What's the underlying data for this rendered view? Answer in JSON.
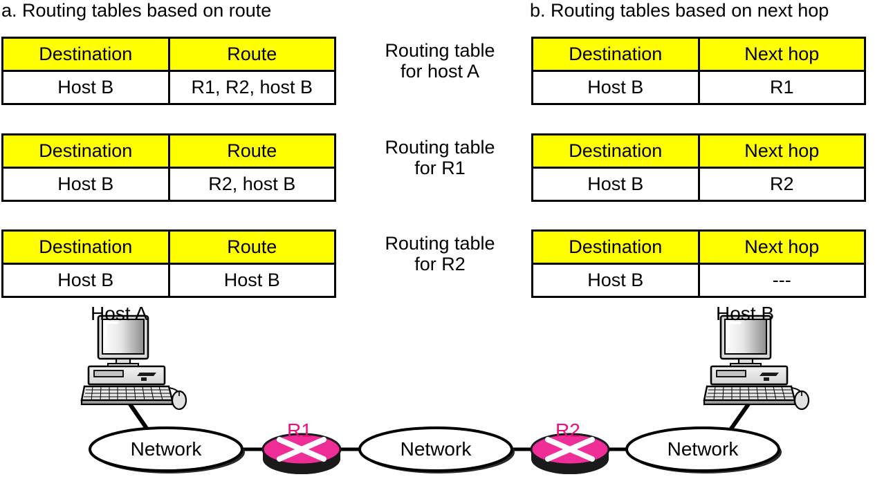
{
  "captions": {
    "a": "a. Routing tables based on route",
    "b": "b. Routing tables based on next hop"
  },
  "center_labels": [
    "Routing table\nfor host A",
    "Routing table\nfor R1",
    "Routing table\nfor R2"
  ],
  "tables_route": [
    {
      "title": "Routing table for host A",
      "headers": [
        "Destination",
        "Route"
      ],
      "rows": [
        [
          "Host B",
          "R1, R2, host B"
        ]
      ]
    },
    {
      "title": "Routing table for R1",
      "headers": [
        "Destination",
        "Route"
      ],
      "rows": [
        [
          "Host B",
          "R2, host B"
        ]
      ]
    },
    {
      "title": "Routing table for R2",
      "headers": [
        "Destination",
        "Route"
      ],
      "rows": [
        [
          "Host B",
          "Host B"
        ]
      ]
    }
  ],
  "tables_nexthop": [
    {
      "title": "Routing table for host A",
      "headers": [
        "Destination",
        "Next hop"
      ],
      "rows": [
        [
          "Host B",
          "R1"
        ]
      ]
    },
    {
      "title": "Routing table for R1",
      "headers": [
        "Destination",
        "Next hop"
      ],
      "rows": [
        [
          "Host B",
          "R2"
        ]
      ]
    },
    {
      "title": "Routing table for R2",
      "headers": [
        "Destination",
        "Next hop"
      ],
      "rows": [
        [
          "Host B",
          "---"
        ]
      ]
    }
  ],
  "diagram": {
    "hosts": [
      {
        "label": "Host A"
      },
      {
        "label": "Host B"
      }
    ],
    "routers": [
      {
        "label": "R1"
      },
      {
        "label": "R2"
      }
    ],
    "networks": [
      {
        "label": "Network"
      },
      {
        "label": "Network"
      },
      {
        "label": "Network"
      }
    ]
  },
  "colors": {
    "header_fill": "#ffff00",
    "router_fill": "#ef2d96",
    "router_label": "#ed0f7a",
    "border": "#000000",
    "background": "#ffffff"
  }
}
